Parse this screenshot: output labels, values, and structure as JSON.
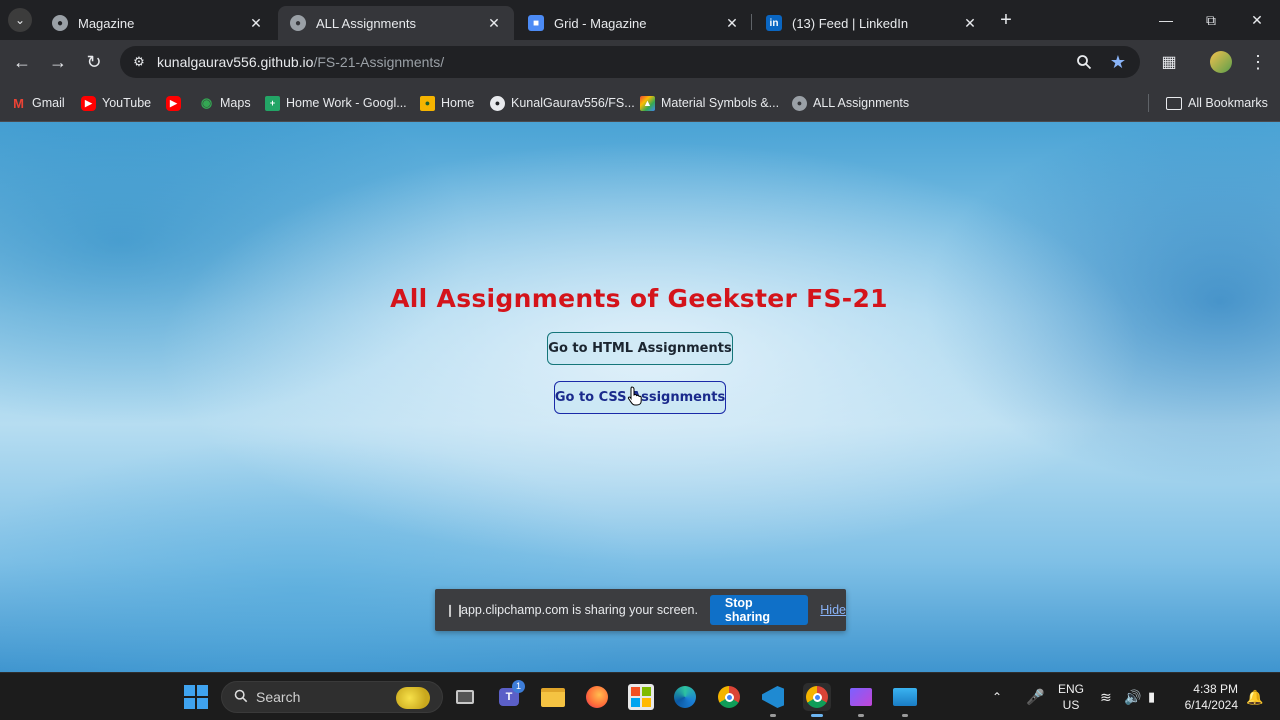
{
  "browser": {
    "tabs": [
      {
        "title": "Magazine",
        "active": false
      },
      {
        "title": "ALL Assignments",
        "active": true
      },
      {
        "title": "Grid - Magazine",
        "active": false
      },
      {
        "title": "(13) Feed | LinkedIn",
        "active": false
      }
    ],
    "address": {
      "host": "kunalgaurav556.github.io",
      "path": "/FS-21-Assignments/"
    },
    "bookmarks": [
      {
        "label": "Gmail"
      },
      {
        "label": "YouTube"
      },
      {
        "label": ""
      },
      {
        "label": "Maps"
      },
      {
        "label": "Home Work - Googl..."
      },
      {
        "label": "Home"
      },
      {
        "label": "KunalGaurav556/FS..."
      },
      {
        "label": "Material Symbols &..."
      },
      {
        "label": "ALL Assignments"
      }
    ],
    "all_bookmarks_label": "All Bookmarks"
  },
  "page": {
    "title": "All Assignments of Geekster FS-21",
    "html_button": "Go to HTML Assignments",
    "css_button": "Go to CSS Assignments",
    "title_color": "#d4141b"
  },
  "share_bar": {
    "message": "app.clipchamp.com is sharing your screen.",
    "stop_label": "Stop sharing",
    "hide_label": "Hide"
  },
  "taskbar": {
    "search_label": "Search",
    "teams_badge": "1",
    "language": {
      "line1": "ENG",
      "line2": "US"
    },
    "time": "4:38 PM",
    "date": "6/14/2024"
  }
}
